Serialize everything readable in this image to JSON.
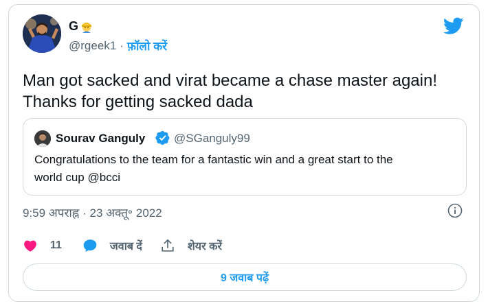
{
  "author": {
    "name": "G",
    "handle": "@rgeek1",
    "separator": "·",
    "follow_label": "फ़ॉलो करें"
  },
  "tweet": {
    "text_line1": "Man got sacked and virat became a chase master again!",
    "text_line2": "Thanks for getting sacked dada"
  },
  "quoted_tweet": {
    "name": "Sourav Ganguly",
    "handle": "@SGanguly99",
    "text_line1": "Congratulations to the team for a fantastic win and a great start to the",
    "text_line2": "world cup @bcci"
  },
  "timestamp": "9:59 अपराह्न · 23 अक्तू॰ 2022",
  "actions": {
    "like_count": "11",
    "reply_label": "जवाब दें",
    "share_label": "शेयर करें"
  },
  "replies_button_label": "9 जवाब पढ़ें",
  "colors": {
    "accent": "#1d9bf0",
    "like": "#f91880",
    "text_secondary": "#536471",
    "border": "#cfd9de"
  },
  "icons": [
    "twitter-bird-icon",
    "verified-badge-icon",
    "info-icon",
    "heart-icon",
    "reply-icon",
    "share-icon",
    "emoji-icon"
  ]
}
